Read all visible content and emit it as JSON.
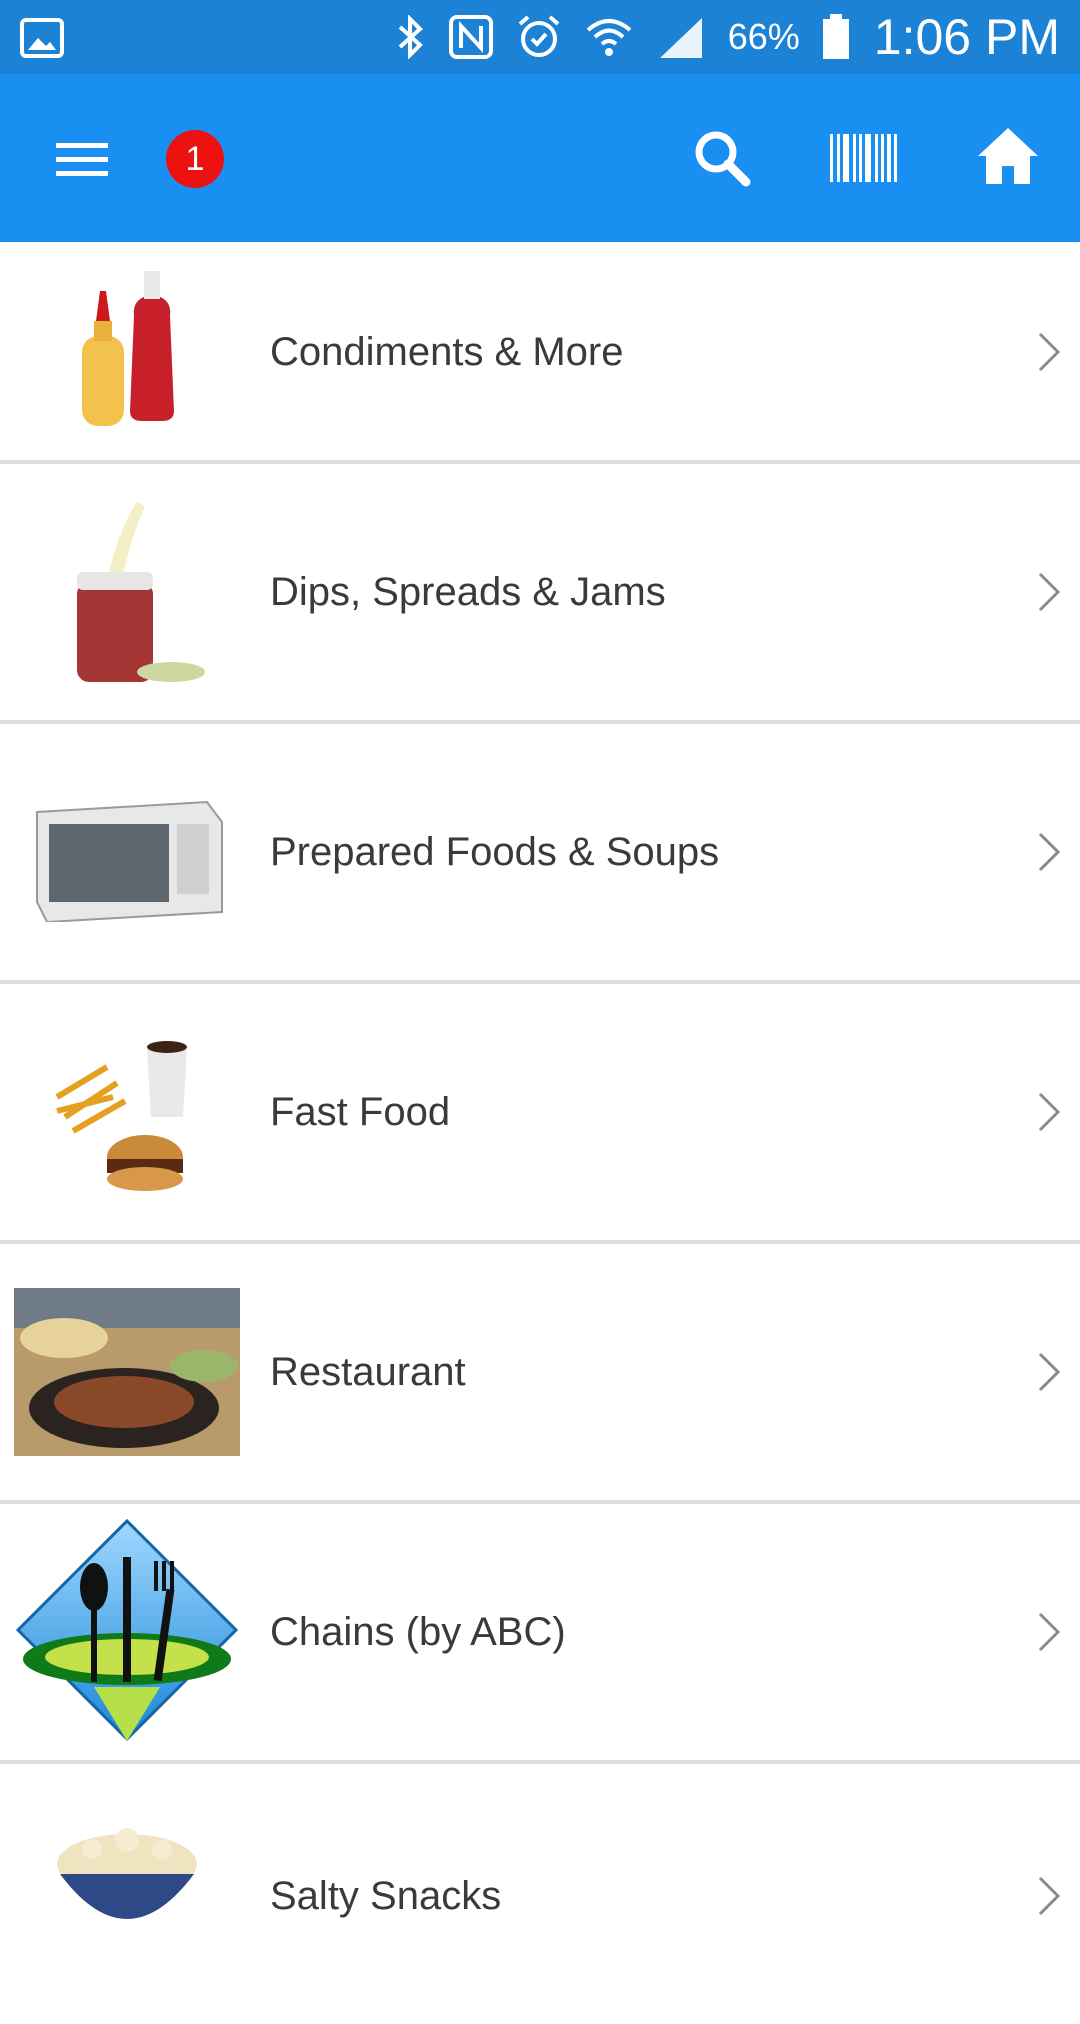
{
  "status_bar": {
    "icons": [
      "gallery-icon",
      "bluetooth-icon",
      "nfc-icon",
      "alarm-icon",
      "wifi-icon",
      "signal-icon",
      "battery-icon"
    ],
    "battery": "66%",
    "time": "1:06 PM"
  },
  "app_bar": {
    "icons": [
      "menu-icon",
      "search-icon",
      "barcode-icon",
      "home-icon"
    ],
    "badge_count": "1"
  },
  "categories": [
    {
      "label": "Condiments & More"
    },
    {
      "label": "Dips, Spreads & Jams"
    },
    {
      "label": "Prepared Foods & Soups"
    },
    {
      "label": "Fast Food"
    },
    {
      "label": "Restaurant"
    },
    {
      "label": "Chains (by ABC)"
    },
    {
      "label": "Salty Snacks"
    }
  ],
  "colors": {
    "status_bar": "#1c82d6",
    "app_bar": "#1a8ff2",
    "badge": "#ee1111"
  }
}
